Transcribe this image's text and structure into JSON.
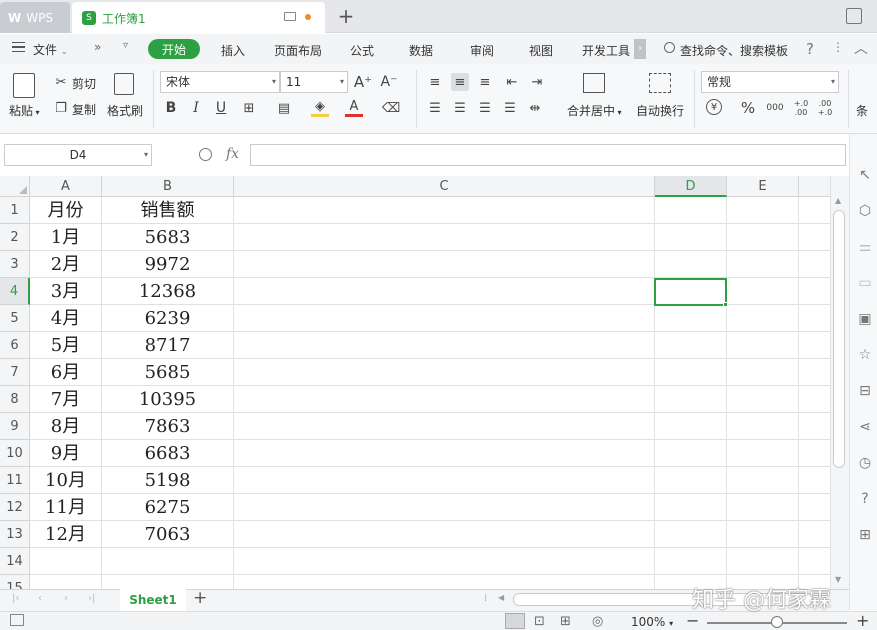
{
  "titlebar": {
    "app_tab": "WPS",
    "doc_tab": "工作簿1",
    "new_tab": "+"
  },
  "menu": {
    "file": "文件",
    "items": [
      "开始",
      "插入",
      "页面布局",
      "公式",
      "数据",
      "审阅",
      "视图",
      "开发工具"
    ],
    "search": "查找命令、搜索模板",
    "help": "?"
  },
  "ribbon": {
    "paste": "粘贴",
    "cut": "剪切",
    "copy": "复制",
    "format_painter": "格式刷",
    "font_name": "宋体",
    "font_size": "11",
    "bold": "B",
    "italic": "I",
    "underline": "U",
    "merge_center": "合并居中",
    "wrap_text": "自动换行",
    "number_format": "常规",
    "percent": "%",
    "currency": "¥",
    "thousands": "000",
    "inc_decimal": "+.0 .00",
    "dec_decimal": ".00 +.0",
    "conditional": "条"
  },
  "formula_bar": {
    "name_box": "D4",
    "fx": "fx",
    "formula": ""
  },
  "sheet": {
    "columns": [
      "A",
      "B",
      "C",
      "D",
      "E"
    ],
    "rows": [
      "1",
      "2",
      "3",
      "4",
      "5",
      "6",
      "7",
      "8",
      "9",
      "10",
      "11",
      "12",
      "13",
      "14",
      "15"
    ],
    "headers": {
      "a": "月份",
      "b": "销售额"
    },
    "data": [
      {
        "month": "1月",
        "sales": "5683"
      },
      {
        "month": "2月",
        "sales": "9972"
      },
      {
        "month": "3月",
        "sales": "12368"
      },
      {
        "month": "4月",
        "sales": "6239"
      },
      {
        "month": "5月",
        "sales": "8717"
      },
      {
        "month": "6月",
        "sales": "5685"
      },
      {
        "month": "7月",
        "sales": "10395"
      },
      {
        "month": "8月",
        "sales": "7863"
      },
      {
        "month": "9月",
        "sales": "6683"
      },
      {
        "month": "10月",
        "sales": "5198"
      },
      {
        "month": "11月",
        "sales": "6275"
      },
      {
        "month": "12月",
        "sales": "7063"
      }
    ],
    "selected_cell": "D4"
  },
  "sheetbar": {
    "sheet_name": "Sheet1",
    "add_sheet": "+"
  },
  "statusbar": {
    "zoom": "100%",
    "minus": "−",
    "plus": "+"
  },
  "watermark": "知乎 @何家霖",
  "colors": {
    "accent": "#2ea043",
    "selection": "#2ea043"
  }
}
